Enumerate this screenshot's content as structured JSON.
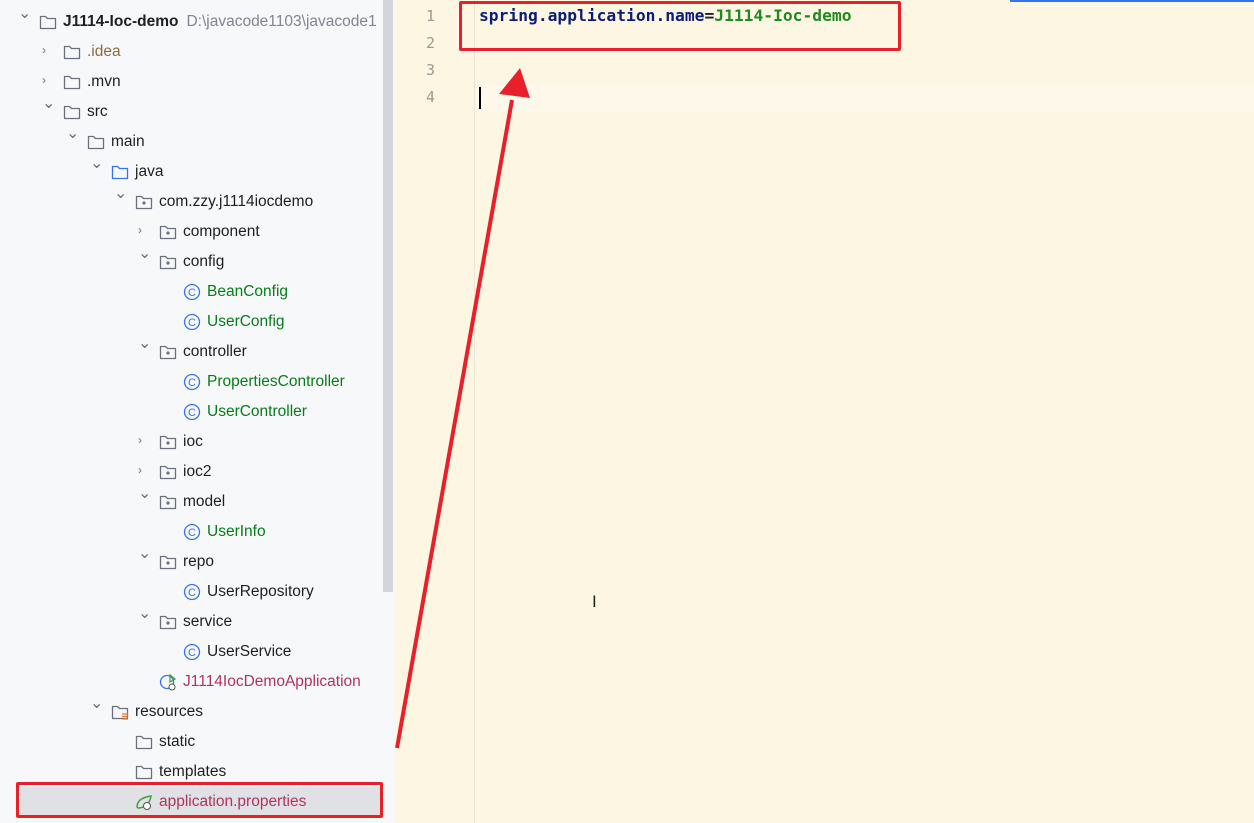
{
  "project_tree": {
    "root": {
      "name": "J1114-Ioc-demo",
      "path": "D:\\javacode1103\\javacode1"
    },
    "items": [
      {
        "label": ".idea",
        "level": 1,
        "type": "folder",
        "expanded": false,
        "color": "#8c6c3e"
      },
      {
        "label": ".mvn",
        "level": 1,
        "type": "folder",
        "expanded": false
      },
      {
        "label": "src",
        "level": 1,
        "type": "folder",
        "expanded": true
      },
      {
        "label": "main",
        "level": 2,
        "type": "folder",
        "expanded": true
      },
      {
        "label": "java",
        "level": 3,
        "type": "source-folder",
        "expanded": true
      },
      {
        "label": "com.zzy.j1114iocdemo",
        "level": 4,
        "type": "package",
        "expanded": true
      },
      {
        "label": "component",
        "level": 5,
        "type": "package",
        "expanded": false
      },
      {
        "label": "config",
        "level": 5,
        "type": "package",
        "expanded": true
      },
      {
        "label": "BeanConfig",
        "level": 6,
        "type": "class",
        "color": "#067d17"
      },
      {
        "label": "UserConfig",
        "level": 6,
        "type": "class",
        "color": "#067d17"
      },
      {
        "label": "controller",
        "level": 5,
        "type": "package",
        "expanded": true
      },
      {
        "label": "PropertiesController",
        "level": 6,
        "type": "class",
        "color": "#067d17"
      },
      {
        "label": "UserController",
        "level": 6,
        "type": "class",
        "color": "#067d17"
      },
      {
        "label": "ioc",
        "level": 5,
        "type": "package",
        "expanded": false
      },
      {
        "label": "ioc2",
        "level": 5,
        "type": "package",
        "expanded": false
      },
      {
        "label": "model",
        "level": 5,
        "type": "package",
        "expanded": true
      },
      {
        "label": "UserInfo",
        "level": 6,
        "type": "class",
        "color": "#067d17"
      },
      {
        "label": "repo",
        "level": 5,
        "type": "package",
        "expanded": true
      },
      {
        "label": "UserRepository",
        "level": 6,
        "type": "class"
      },
      {
        "label": "service",
        "level": 5,
        "type": "package",
        "expanded": true
      },
      {
        "label": "UserService",
        "level": 6,
        "type": "class"
      },
      {
        "label": "J1114IocDemoApplication",
        "level": 5,
        "type": "spring-app",
        "color": "#b4335a"
      },
      {
        "label": "resources",
        "level": 3,
        "type": "resources-folder",
        "expanded": true
      },
      {
        "label": "static",
        "level": 4,
        "type": "folder"
      },
      {
        "label": "templates",
        "level": 4,
        "type": "folder"
      },
      {
        "label": "application.properties",
        "level": 4,
        "type": "properties",
        "color": "#b4335a",
        "selected": true
      }
    ]
  },
  "editor": {
    "line_numbers": [
      "1",
      "2",
      "3",
      "4"
    ],
    "line1": {
      "key": "spring.application.name",
      "eq": "=",
      "value": "J1114-Ioc-demo"
    }
  },
  "annotation_color": "#e8202a"
}
